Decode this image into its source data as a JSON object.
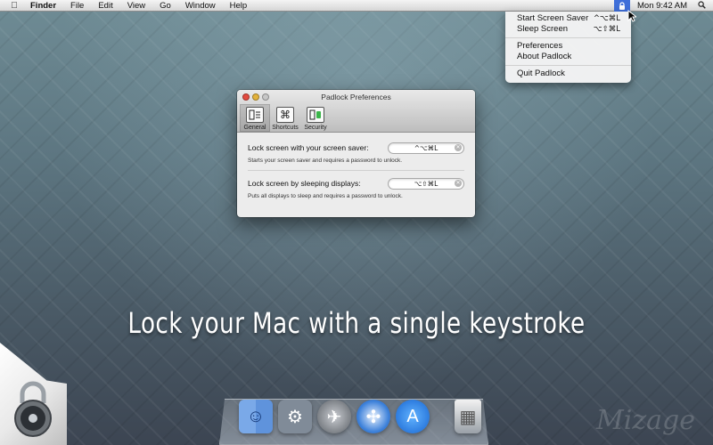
{
  "menubar": {
    "apple_icon": "apple-icon",
    "items": [
      "Finder",
      "File",
      "Edit",
      "View",
      "Go",
      "Window",
      "Help"
    ],
    "status_icon": "padlock-status-icon",
    "clock": "Mon 9:42 AM",
    "spotlight_icon": "spotlight-search-icon"
  },
  "dropdown": {
    "start_screen_saver": "Start Screen Saver",
    "start_shortcut": "^⌥⌘L",
    "sleep_screen": "Sleep Screen",
    "sleep_shortcut": "⌥⇧⌘L",
    "preferences": "Preferences",
    "about": "About Padlock",
    "quit": "Quit Padlock"
  },
  "prefs": {
    "title": "Padlock Preferences",
    "tabs": [
      {
        "label": "General",
        "icon": "general-icon"
      },
      {
        "label": "Shortcuts",
        "icon": "command-key-icon"
      },
      {
        "label": "Security",
        "icon": "security-icon"
      }
    ],
    "screensaver_label": "Lock screen with your screen saver:",
    "screensaver_shortcut": "^⌥⌘L",
    "screensaver_desc": "Starts your screen saver and requires a password to unlock.",
    "sleep_label": "Lock screen by sleeping displays:",
    "sleep_shortcut": "⌥⇧⌘L",
    "sleep_desc": "Puts all displays to sleep and requires a password to unlock."
  },
  "tagline": "Lock your Mac with a single keystroke",
  "watermark": "Mizage",
  "dock": [
    {
      "name": "Finder",
      "icon": "finder-icon"
    },
    {
      "name": "System Preferences",
      "icon": "system-preferences-icon"
    },
    {
      "name": "Launchpad",
      "icon": "launchpad-icon"
    },
    {
      "name": "Safari",
      "icon": "safari-icon"
    },
    {
      "name": "App Store",
      "icon": "app-store-icon"
    },
    {
      "name": "Trash",
      "icon": "trash-icon"
    }
  ],
  "colors": {
    "status_highlight": "#3f6fd9",
    "desktop": "#5d7681"
  }
}
